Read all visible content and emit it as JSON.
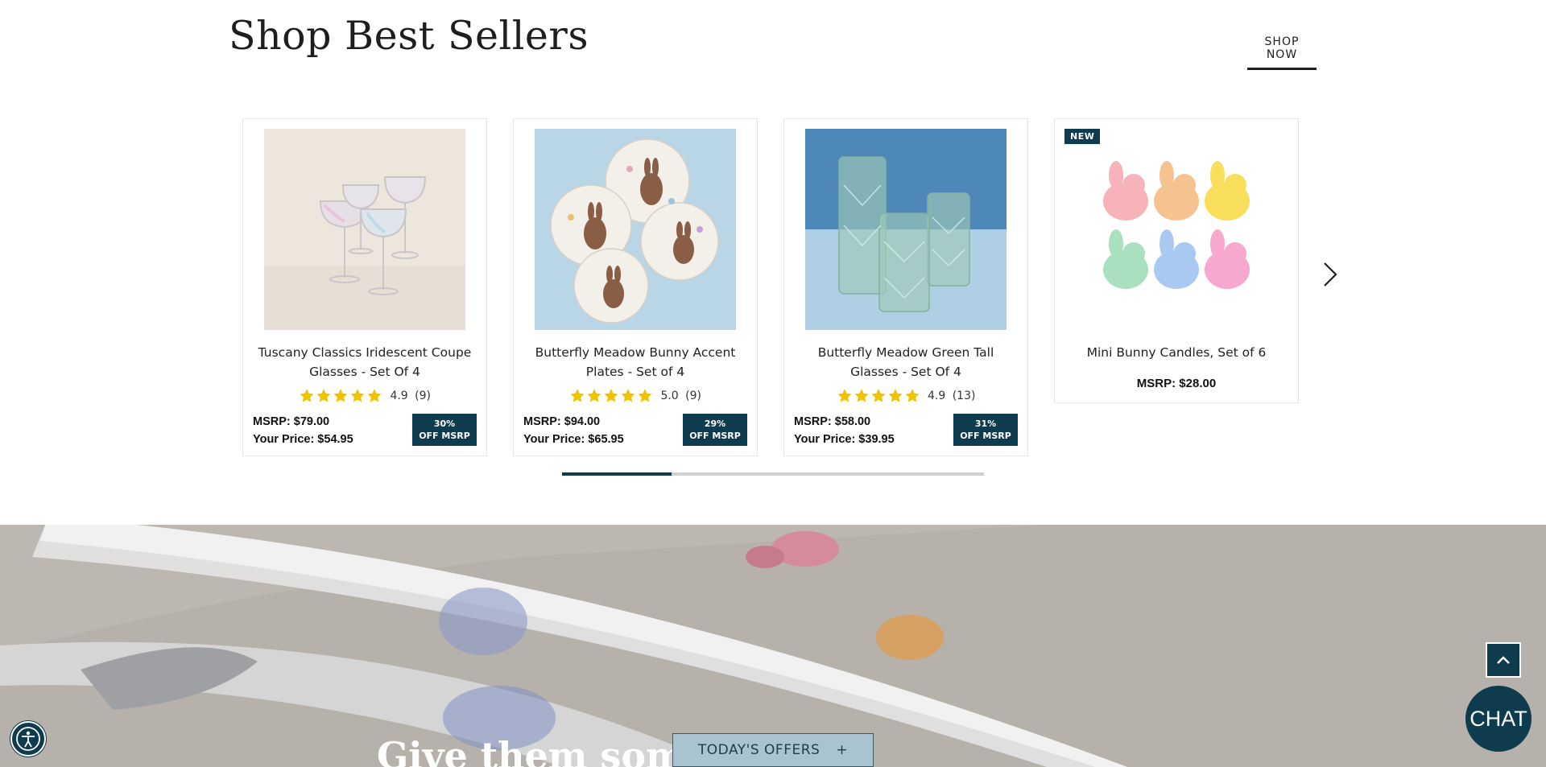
{
  "section": {
    "title": "Shop Best Sellers",
    "shop_now": "SHOP NOW"
  },
  "products": [
    {
      "name": "Tuscany Classics Iridescent Coupe Glasses - Set Of 4",
      "rating": "4.9",
      "reviews": "(9)",
      "msrp": "MSRP: $79.00",
      "your_price": "Your Price: $54.95",
      "discount_line1": "30%",
      "discount_line2": "OFF MSRP"
    },
    {
      "name": "Butterfly Meadow Bunny Accent Plates - Set of 4",
      "rating": "5.0",
      "reviews": "(9)",
      "msrp": "MSRP: $94.00",
      "your_price": "Your Price: $65.95",
      "discount_line1": "29%",
      "discount_line2": "OFF MSRP"
    },
    {
      "name": "Butterfly Meadow Green Tall Glasses - Set Of 4",
      "rating": "4.9",
      "reviews": "(13)",
      "msrp": "MSRP: $58.00",
      "your_price": "Your Price: $39.95",
      "discount_line1": "31%",
      "discount_line2": "OFF MSRP"
    },
    {
      "badge": "NEW",
      "name": "Mini Bunny Candles, Set of 6",
      "msrp": "MSRP: $28.00"
    }
  ],
  "carousel": {
    "progress": 0.26
  },
  "hero": {
    "headline_partial": "Give them some..."
  },
  "widgets": {
    "offers_label": "TODAY'S OFFERS",
    "offers_icon": "+",
    "chat_label": "CHAT"
  },
  "colors": {
    "brand_navy": "#0f3b4f",
    "star_gold": "#f2c200",
    "offers_bg": "#a9c4cf"
  }
}
